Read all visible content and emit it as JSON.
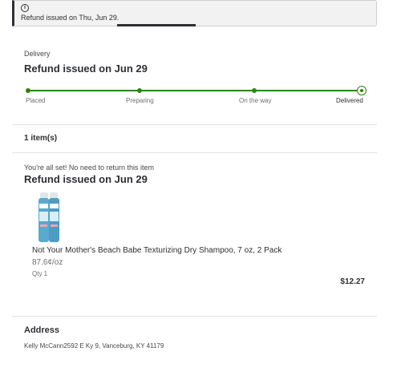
{
  "banner": {
    "icon": "info-icon",
    "icon_glyph": "i",
    "message": "Refund issued on Thu, Jun 29."
  },
  "delivery": {
    "label": "Delivery",
    "status_title": "Refund issued on Jun 29",
    "accent_color": "#2a8703",
    "steps": [
      {
        "label": "Placed"
      },
      {
        "label": "Preparing"
      },
      {
        "label": "On the way"
      },
      {
        "label": "Delivered"
      }
    ]
  },
  "items": {
    "count_label": "1 item(s)",
    "note": "You're all set! No need to return this item",
    "status_title": "Refund issued on Jun 29",
    "product": {
      "image": "dry-shampoo-product-image",
      "name": "Not Your Mother's Beach Babe Texturizing Dry Shampoo, 7 oz, 2 Pack",
      "unit_price": "87.6¢/oz",
      "qty": "Qty 1",
      "price": "$12.27"
    }
  },
  "address": {
    "title": "Address",
    "text": "Kelly McCann2592 E Ky 9, Vanceburg, KY 41179"
  }
}
